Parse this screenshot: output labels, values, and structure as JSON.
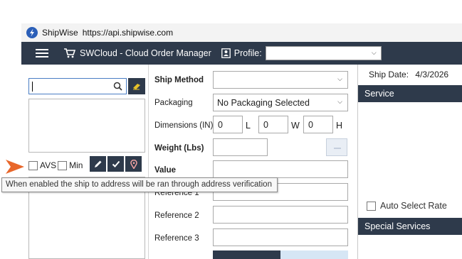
{
  "window": {
    "app_name": "ShipWise",
    "url": "https://api.shipwise.com"
  },
  "toolbar": {
    "title": "SWCloud - Cloud Order Manager",
    "profile_label": "Profile:",
    "profile_value": ""
  },
  "left": {
    "search_placeholder": "",
    "avs_label": "AVS",
    "min_label": "Min",
    "icons": [
      "eraser-icon",
      "pencil-icon",
      "check-icon",
      "map-pin-icon"
    ]
  },
  "form": {
    "ship_method_label": "Ship Method",
    "ship_method_value": "",
    "packaging_label": "Packaging",
    "packaging_value": "No Packaging Selected",
    "dimensions_label": "Dimensions (IN)",
    "dim_l": "0",
    "dim_w": "0",
    "dim_h": "0",
    "l_letter": "L",
    "w_letter": "W",
    "h_letter": "H",
    "weight_label": "Weight (Lbs)",
    "value_label": "Value",
    "reference1_label": "Reference 1",
    "reference2_label": "Reference 2",
    "reference3_label": "Reference 3"
  },
  "right": {
    "ship_date_label": "Ship Date:",
    "ship_date_value": "4/3/2026",
    "service_label": "Service",
    "auto_select_label": "Auto Select Rate",
    "special_services_label": "Special Services"
  },
  "tooltip": {
    "text": "When enabled the ship to address will be ran through address verification"
  },
  "colors": {
    "navy": "#2e3a4b",
    "accent_arrow": "#e8672b",
    "focus_blue": "#4a7dc4"
  }
}
